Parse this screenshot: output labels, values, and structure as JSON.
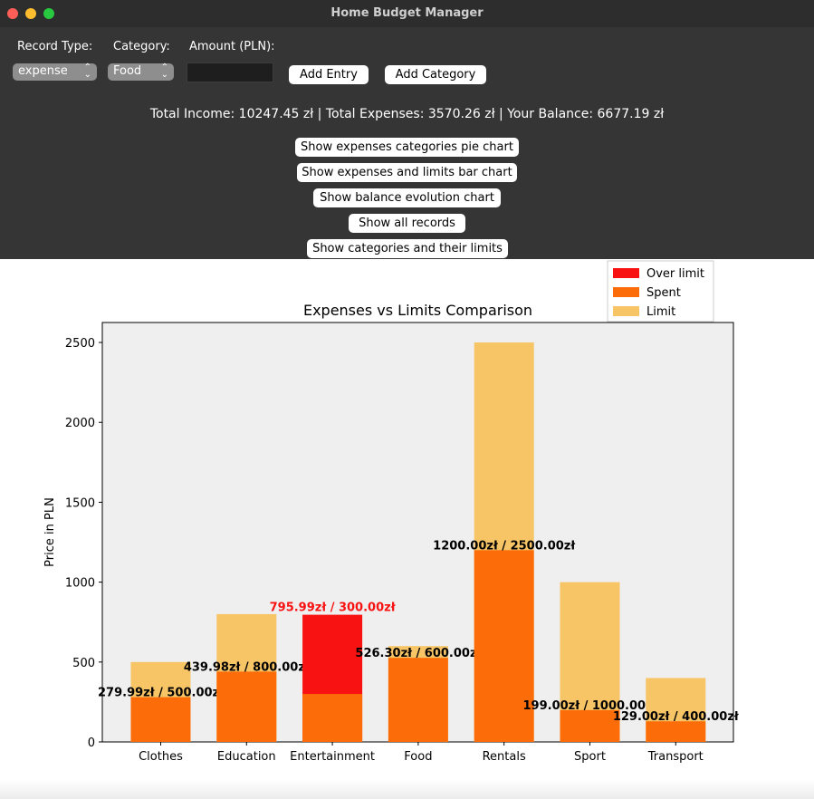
{
  "window": {
    "title": "Home Budget Manager"
  },
  "form": {
    "record_type_label": "Record Type:",
    "category_label": "Category:",
    "amount_label": "Amount (PLN):",
    "record_type_value": "expense",
    "category_value": "Food",
    "amount_value": "",
    "add_entry_label": "Add Entry",
    "add_category_label": "Add Category"
  },
  "summary": {
    "text": "Total Income: 10247.45 zł | Total Expenses: 3570.26 zł | Your Balance: 6677.19 zł"
  },
  "actions": {
    "pie_chart": "Show expenses categories pie chart",
    "bar_chart": "Show expenses and limits bar chart",
    "balance_chart": "Show balance evolution chart",
    "all_records": "Show all records",
    "categories_limits": "Show categories and their limits"
  },
  "colors": {
    "over_limit": "#f81212",
    "spent": "#fc6d0a",
    "limit": "#f7c466",
    "plot_bg": "#efefef"
  },
  "chart_data": {
    "type": "bar",
    "title": "Expenses vs Limits Comparison",
    "xlabel": "",
    "ylabel": "Price in PLN",
    "ylim": [
      0,
      2500
    ],
    "yticks": [
      0,
      500,
      1000,
      1500,
      2000,
      2500
    ],
    "grid": false,
    "legend_position": "top-right",
    "categories": [
      "Clothes",
      "Education",
      "Entertainment",
      "Food",
      "Rentals",
      "Sport",
      "Transport"
    ],
    "series": [
      {
        "name": "Over limit",
        "color": "#f81212",
        "values": [
          0,
          0,
          795.99,
          0,
          0,
          0,
          0
        ]
      },
      {
        "name": "Spent",
        "color": "#fc6d0a",
        "values": [
          279.99,
          439.98,
          300.0,
          526.3,
          1200.0,
          199.0,
          129.0
        ]
      },
      {
        "name": "Limit",
        "color": "#f7c466",
        "values": [
          500.0,
          800.0,
          300.0,
          600.0,
          2500.0,
          1000.0,
          400.0
        ]
      }
    ],
    "annotations": [
      {
        "category": "Clothes",
        "text": "279.99zł / 500.00zł",
        "over": false
      },
      {
        "category": "Education",
        "text": "439.98zł / 800.00zł",
        "over": false
      },
      {
        "category": "Entertainment",
        "text": "795.99zł / 300.00zł",
        "over": true
      },
      {
        "category": "Food",
        "text": "526.30zł / 600.00zł",
        "over": false
      },
      {
        "category": "Rentals",
        "text": "1200.00zł / 2500.00zł",
        "over": false
      },
      {
        "category": "Sport",
        "text": "199.00zł / 1000.00zł",
        "over": false
      },
      {
        "category": "Transport",
        "text": "129.00zł / 400.00zł",
        "over": false
      }
    ]
  }
}
